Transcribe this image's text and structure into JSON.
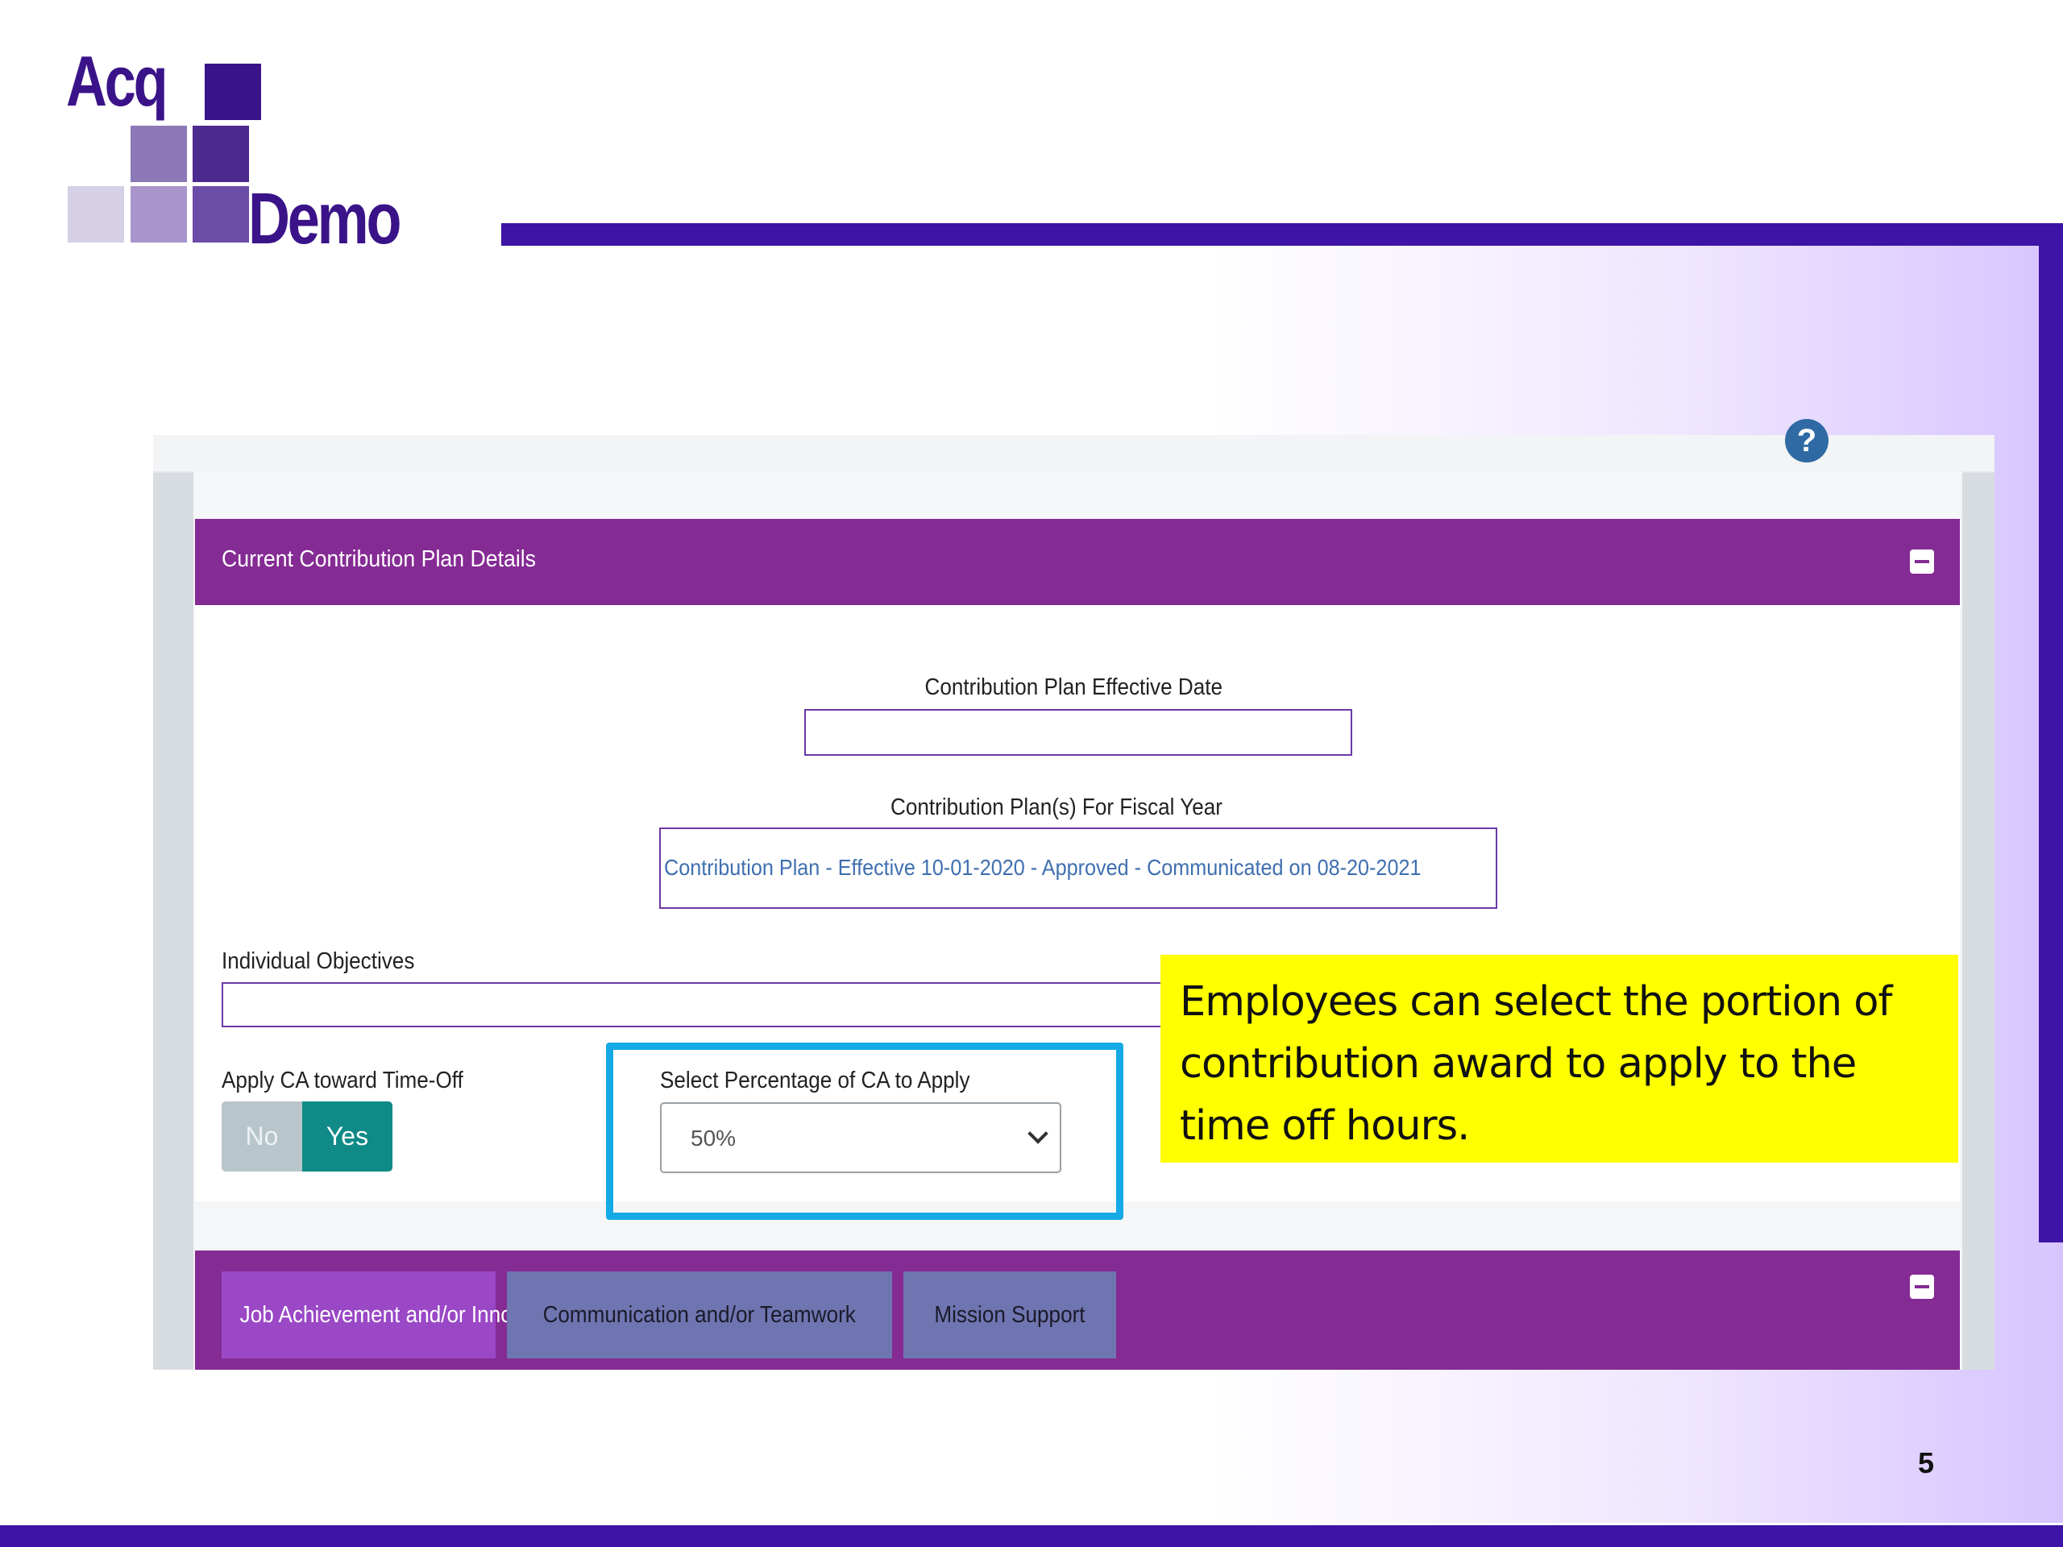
{
  "branding": {
    "logo_line1": "Acq",
    "logo_line2": "Demo",
    "colors": {
      "brand_dark": "#3d14a5",
      "panel_purple": "#852b94",
      "toggle_teal": "#0f8a87",
      "highlight_blue": "#15a9e6",
      "callout_yellow": "#ffff00"
    }
  },
  "page_number": "5",
  "panel": {
    "title": "Current Contribution Plan Details",
    "collapse_icon": "minus-square-icon"
  },
  "form": {
    "effective_date": {
      "label": "Contribution Plan Effective Date",
      "value": ""
    },
    "fiscal_year_plans": {
      "label": "Contribution Plan(s) For Fiscal Year",
      "value": "Contribution Plan - Effective 10-01-2020 - Approved - Communicated on 08-20-2021"
    },
    "individual_objectives": {
      "label": "Individual Objectives",
      "value": ""
    },
    "apply_ca": {
      "label": "Apply CA toward Time-Off",
      "no_label": "No",
      "yes_label": "Yes",
      "selected": "Yes"
    },
    "percentage": {
      "label": "Select Percentage of CA to Apply",
      "value": "50%"
    }
  },
  "callout": {
    "text": "Employees can select the portion of contribution award to apply to the time off hours."
  },
  "tabs": [
    {
      "label": "Job Achievement and/or Innovation",
      "active": true
    },
    {
      "label": "Communication and/or Teamwork",
      "active": false
    },
    {
      "label": "Mission Support",
      "active": false
    }
  ],
  "help_icon": {
    "glyph": "?",
    "name": "help-icon"
  }
}
